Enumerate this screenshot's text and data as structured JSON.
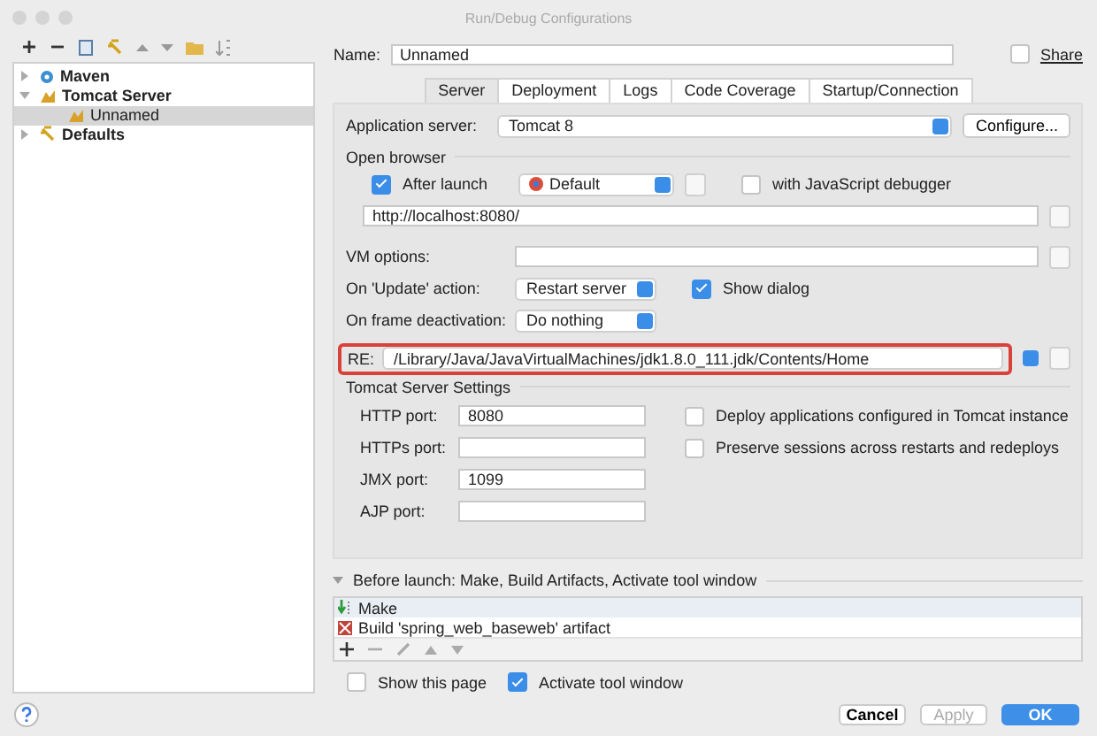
{
  "window": {
    "title": "Run/Debug Configurations"
  },
  "tree": [
    {
      "label": "Maven",
      "kind": "maven",
      "expanded": false,
      "selected": false
    },
    {
      "label": "Tomcat Server",
      "kind": "tomcat",
      "expanded": true,
      "selected": false,
      "children": [
        {
          "label": "Unnamed",
          "kind": "tomcat",
          "selected": true
        }
      ]
    },
    {
      "label": "Defaults",
      "kind": "defaults",
      "expanded": false,
      "selected": false
    }
  ],
  "name": {
    "label": "Name:",
    "value": "Unnamed"
  },
  "share": {
    "label": "Share",
    "checked": false
  },
  "tabs": [
    {
      "label": "Server",
      "selected": true
    },
    {
      "label": "Deployment",
      "selected": false
    },
    {
      "label": "Logs",
      "selected": false
    },
    {
      "label": "Code Coverage",
      "selected": false
    },
    {
      "label": "Startup/Connection",
      "selected": false
    }
  ],
  "app_server": {
    "label": "Application server:",
    "value": "Tomcat 8",
    "button": "Configure..."
  },
  "open_browser": {
    "title": "Open browser",
    "after_launch": {
      "label": "After launch",
      "checked": true
    },
    "browser": "Default",
    "js_debugger": {
      "label": "with JavaScript debugger",
      "checked": false
    },
    "url": "http://localhost:8080/"
  },
  "vm_options": {
    "label": "VM options:"
  },
  "on_update": {
    "label": "On 'Update' action:",
    "value": "Restart server",
    "show_dialog": {
      "label": "Show dialog",
      "checked": true
    }
  },
  "on_frame": {
    "label": "On frame deactivation:",
    "value": "Do nothing"
  },
  "jre": {
    "label": "RE:",
    "value": "/Library/Java/JavaVirtualMachines/jdk1.8.0_111.jdk/Contents/Home"
  },
  "tomcat_settings": {
    "title": "Tomcat Server Settings",
    "ports": [
      {
        "label": "HTTP port:",
        "value": "8080"
      },
      {
        "label": "HTTPs port:"
      },
      {
        "label": "JMX port:",
        "value": "1099"
      },
      {
        "label": "AJP port:"
      }
    ],
    "options": [
      {
        "label": "Deploy applications configured in Tomcat instance",
        "checked": false
      },
      {
        "label": "Preserve sessions across restarts and redeploys",
        "checked": false
      }
    ]
  },
  "before_launch": {
    "title": "Before launch: Make, Build Artifacts, Activate tool window",
    "items": [
      {
        "label": "Make",
        "kind": "make"
      },
      {
        "label": "Build 'spring_web_baseweb' artifact",
        "kind": "artifact"
      }
    ]
  },
  "show_page": {
    "label": "Show this page",
    "checked": false
  },
  "activate_tool": {
    "label": "Activate tool window",
    "checked": true
  },
  "buttons": [
    {
      "label": "Cancel",
      "kind": "normal"
    },
    {
      "label": "Apply",
      "kind": "disabled"
    },
    {
      "label": "OK",
      "kind": "default"
    }
  ]
}
